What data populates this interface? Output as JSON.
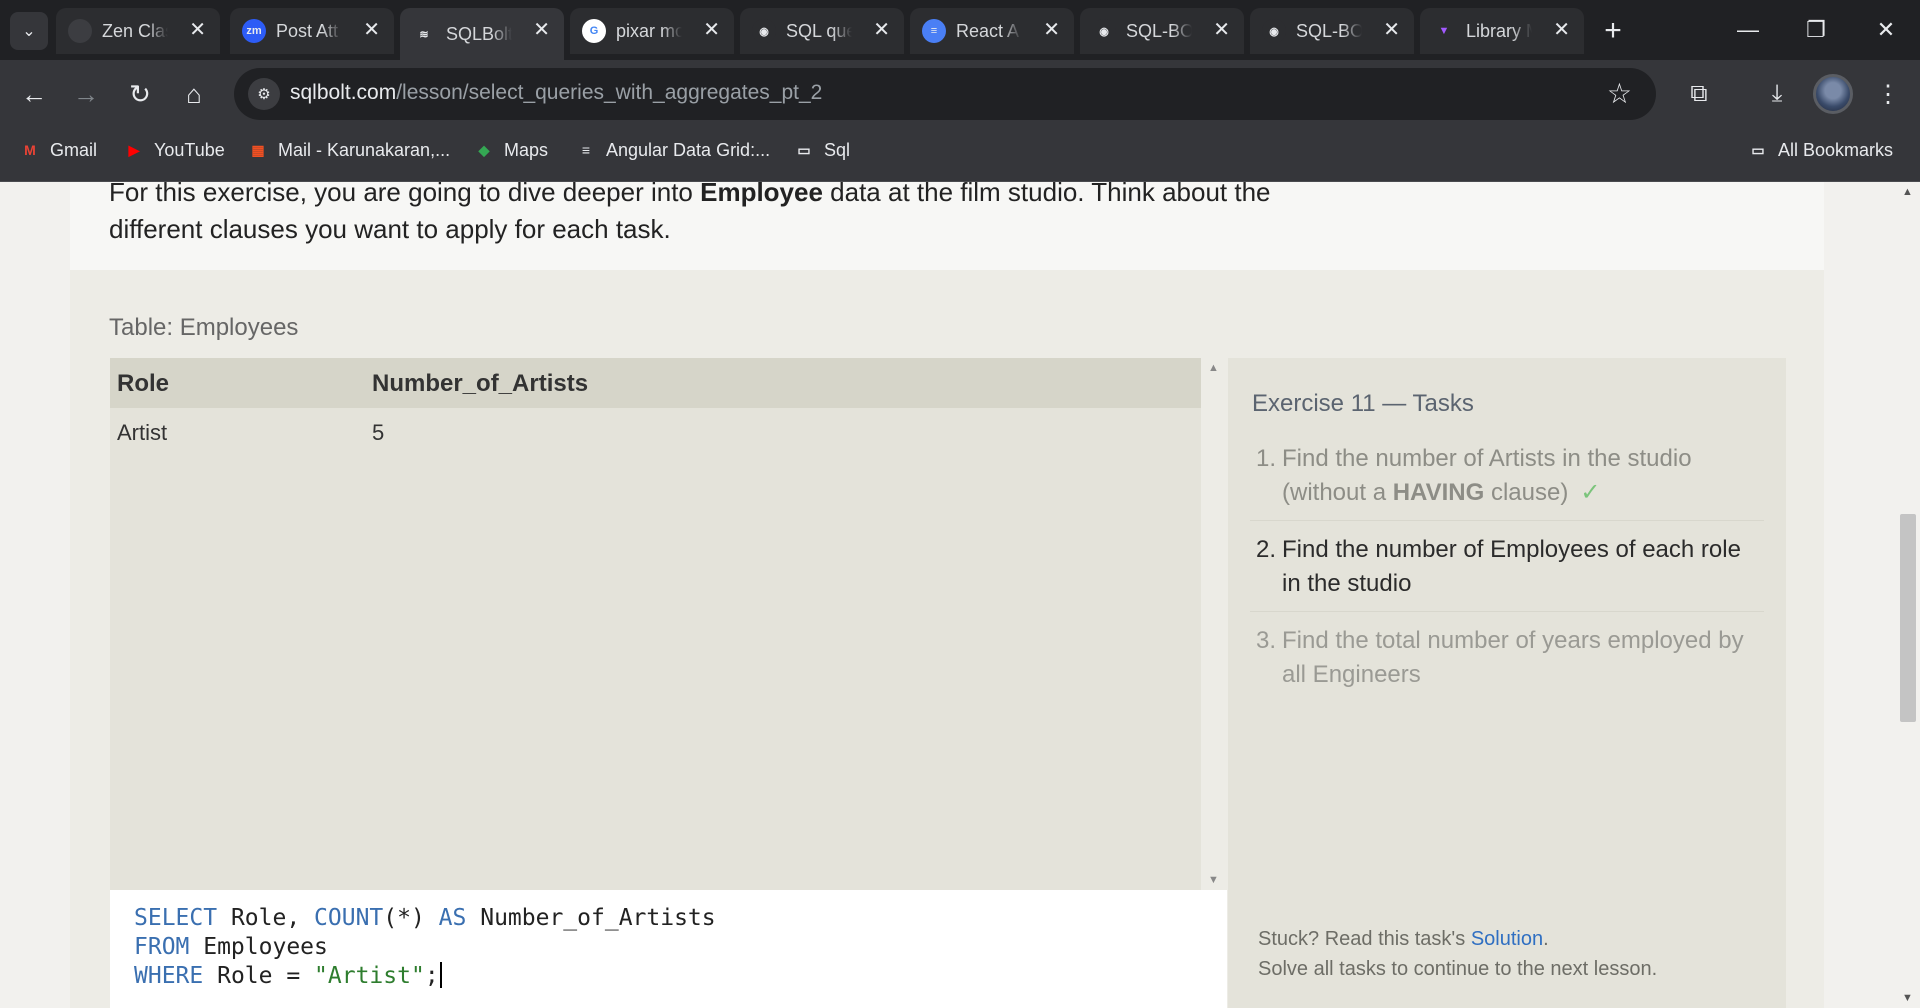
{
  "browser": {
    "tabs": [
      {
        "title": "Zen Clas",
        "icon_bg": "#3c3d41",
        "icon_text": ""
      },
      {
        "title": "Post Att",
        "icon_bg": "#2d5cf6",
        "icon_text": "zm"
      },
      {
        "title": "SQLBolt",
        "icon_bg": "transparent",
        "icon_text": "≋",
        "active": true
      },
      {
        "title": "pixar mo",
        "icon_bg": "#ffffff",
        "icon_text": "G"
      },
      {
        "title": "SQL que",
        "icon_bg": "#2c2d30",
        "icon_text": "◉"
      },
      {
        "title": "React A",
        "icon_bg": "#4a7ff5",
        "icon_text": "≡"
      },
      {
        "title": "SQL-BO",
        "icon_bg": "#2c2d30",
        "icon_text": "◉"
      },
      {
        "title": "SQL-BO",
        "icon_bg": "#2c2d30",
        "icon_text": "◉"
      },
      {
        "title": "Library M",
        "icon_bg": "transparent",
        "icon_text": "▼"
      }
    ],
    "url_host": "sqlbolt.com",
    "url_path": "/lesson/select_queries_with_aggregates_pt_2",
    "bookmarks": [
      {
        "label": "Gmail",
        "icon": "M",
        "icon_color": "#ea4335"
      },
      {
        "label": "YouTube",
        "icon": "▶",
        "icon_color": "#ff0000"
      },
      {
        "label": "Mail - Karunakaran,...",
        "icon": "▦",
        "icon_color": "#f25022"
      },
      {
        "label": "Maps",
        "icon": "◆",
        "icon_color": "#34a853"
      },
      {
        "label": "Angular Data Grid:...",
        "icon": "≡",
        "icon_color": "#e8eaed"
      },
      {
        "label": "Sql",
        "icon": "▭",
        "icon_color": "#e8eaed"
      }
    ],
    "all_bookmarks_label": "All Bookmarks"
  },
  "lesson": {
    "intro_before": "For this exercise, you are going to dive deeper into ",
    "intro_bold": "Employee",
    "intro_after": " data at the film studio. Think about the different clauses you want to apply for each task.",
    "table_caption": "Table: Employees",
    "columns": [
      "Role",
      "Number_of_Artists"
    ],
    "rows": [
      [
        "Artist",
        "5"
      ]
    ],
    "query_lines": [
      [
        {
          "t": "SELECT",
          "kw": true
        },
        {
          "t": " Role, "
        },
        {
          "t": "COUNT",
          "kw": true
        },
        {
          "t": "(*) "
        },
        {
          "t": "AS",
          "kw": true
        },
        {
          "t": " Number_of_Artists"
        }
      ],
      [
        {
          "t": "FROM",
          "kw": true
        },
        {
          "t": " Employees"
        }
      ],
      [
        {
          "t": "WHERE",
          "kw": true
        },
        {
          "t": " Role = "
        },
        {
          "t": "\"Artist\"",
          "str": true
        },
        {
          "t": ";"
        }
      ]
    ],
    "tasks_title": "Exercise 11 — Tasks",
    "tasks": [
      {
        "num": "1.",
        "text_before": "Find the number of Artists in the studio (without a ",
        "bold": "HAVING",
        "text_after": " clause)",
        "state": "done",
        "check": "✓"
      },
      {
        "num": "2.",
        "text_before": "Find the number of Employees of each role in the studio",
        "bold": "",
        "text_after": "",
        "state": "current",
        "check": ""
      },
      {
        "num": "3.",
        "text_before": "Find the total number of years employed by all Engineers",
        "bold": "",
        "text_after": "",
        "state": "future",
        "check": ""
      }
    ],
    "stuck_prefix": "Stuck? Read this task's ",
    "solution_link": "Solution",
    "stuck_suffix": ".",
    "continue_note": "Solve all tasks to continue to the next lesson."
  }
}
